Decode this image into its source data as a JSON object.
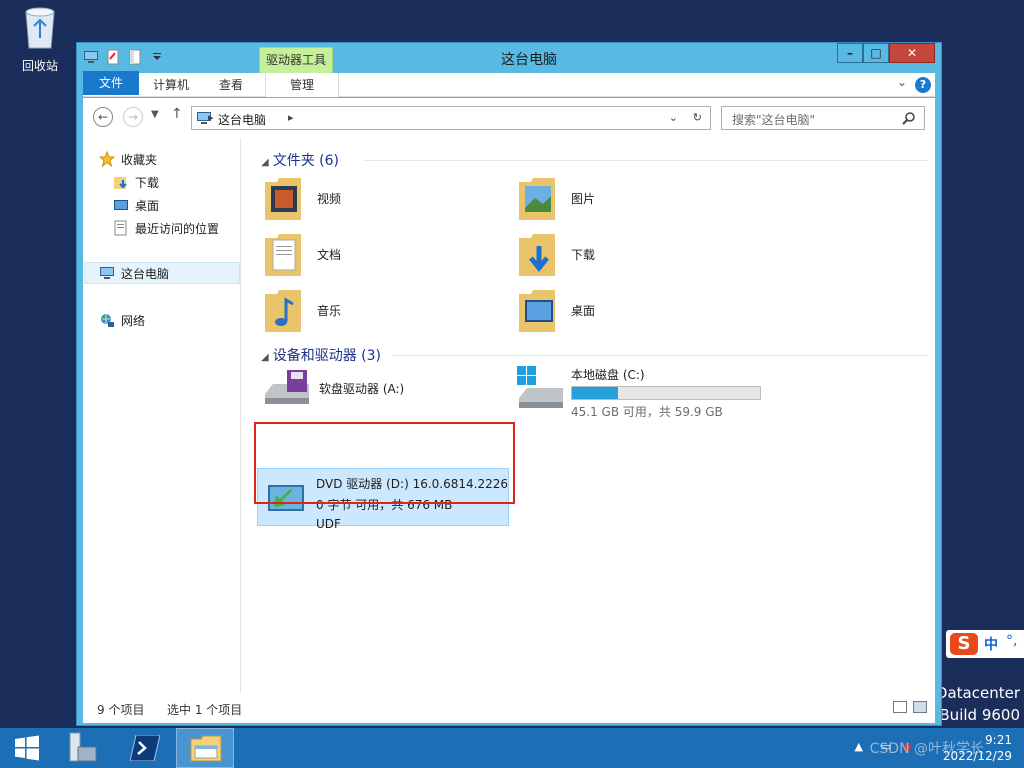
{
  "desktop": {
    "recycle_bin_label": "回收站",
    "sys_edition": "Datacenter",
    "sys_build": "Build 9600"
  },
  "ime": {
    "mode": "中",
    "punct": "°,"
  },
  "window": {
    "title": "这台电脑",
    "context_tab": "驱动器工具",
    "ribbon_tabs": {
      "file": "文件",
      "computer": "计算机",
      "view": "查看",
      "manage": "管理"
    },
    "help_label": "?"
  },
  "nav": {
    "address_path": "这台电脑",
    "search_placeholder": "搜索\"这台电脑\""
  },
  "sidebar": {
    "favorites": "收藏夹",
    "downloads": "下载",
    "desktop": "桌面",
    "recent": "最近访问的位置",
    "this_pc": "这台电脑",
    "network": "网络"
  },
  "folders_group": {
    "heading": "文件夹 (6)",
    "items": [
      "视频",
      "图片",
      "文档",
      "下载",
      "音乐",
      "桌面"
    ]
  },
  "devices_group": {
    "heading": "设备和驱动器 (3)",
    "floppy": {
      "name": "软盘驱动器 (A:)"
    },
    "local_disk": {
      "name": "本地磁盘 (C:)",
      "space": "45.1 GB 可用，共 59.9 GB",
      "used_fraction": 0.247
    },
    "dvd": {
      "name": "DVD 驱动器 (D:) 16.0.6814.2226",
      "space": "0 字节 可用，共 676 MB",
      "fs": "UDF"
    }
  },
  "status": {
    "items": "9 个项目",
    "selected": "选中 1 个项目"
  },
  "taskbar": {
    "time": "9:21",
    "date": "2022/12/29",
    "watermark": "CSDN @叶秋学长"
  },
  "colors": {
    "window_frame": "#58b9e3",
    "file_tab": "#1979ca",
    "context_tab": "#c6ef9a",
    "highlight_red": "#e0241b",
    "disk_fill": "#26a0da",
    "taskbar": "#1d6fb5"
  }
}
